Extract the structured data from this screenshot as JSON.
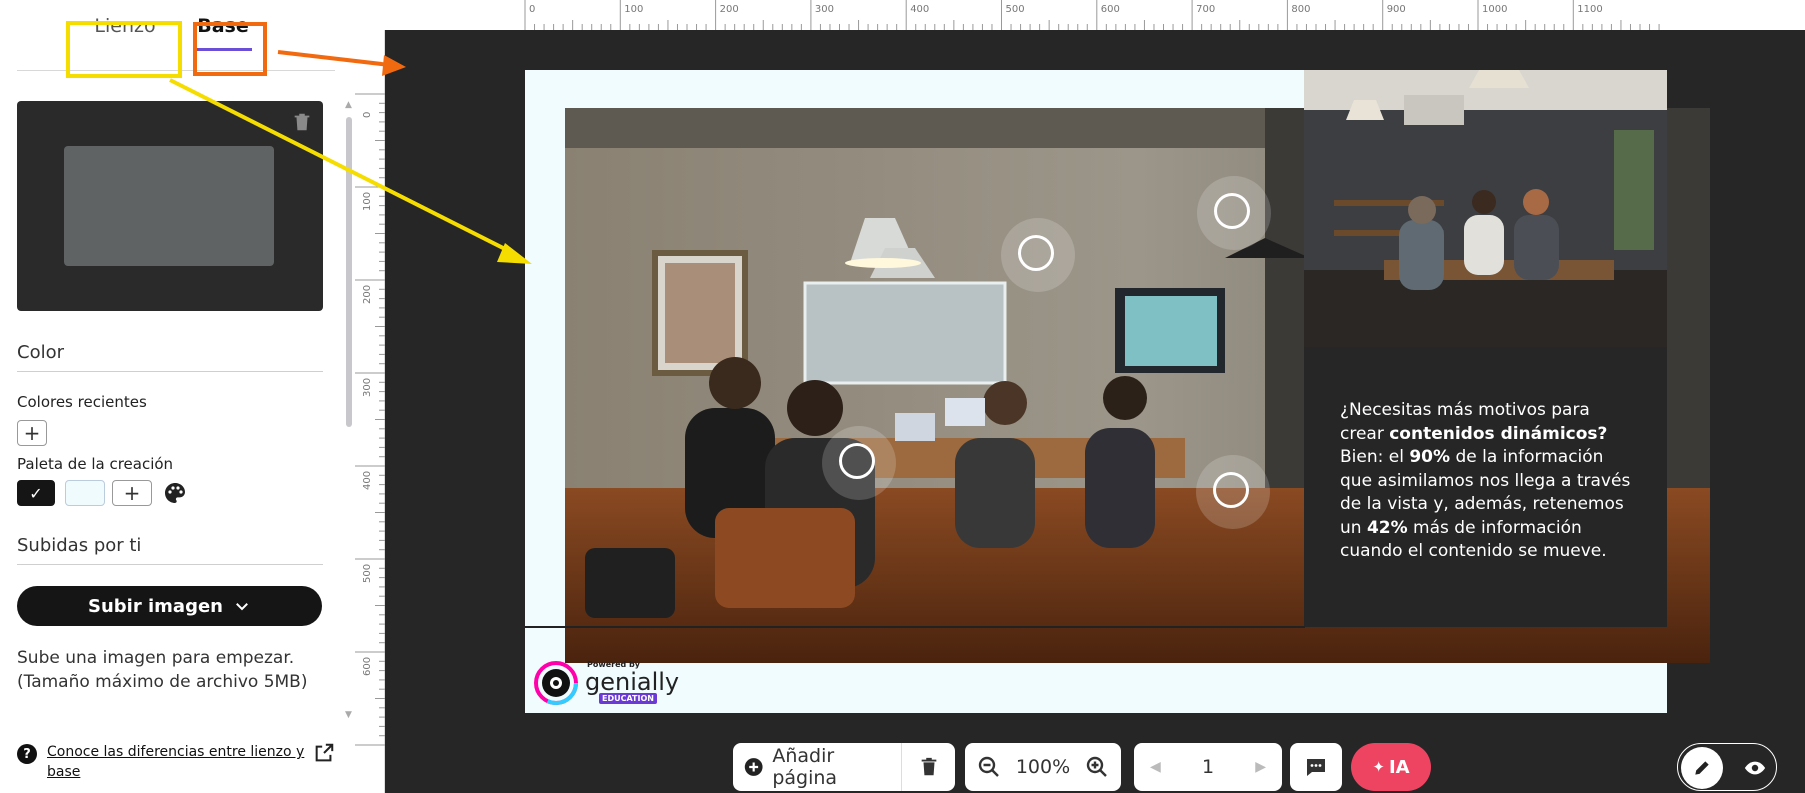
{
  "left_panel": {
    "tabs": [
      {
        "label": "Lienzo"
      },
      {
        "label": "Base"
      }
    ],
    "color": {
      "title": "Color",
      "recent_label": "Colores recientes",
      "palette_label": "Paleta de la creación",
      "palette_swatches": [
        "#151515",
        "#effbfc"
      ]
    },
    "uploads": {
      "title": "Subidas por ti",
      "button_label": "Subir imagen",
      "hint_line1": "Sube una imagen para empezar.",
      "hint_line2": "(Tamaño máximo de archivo 5MB)"
    },
    "help_link": "Conoce las diferencias entre lienzo y base"
  },
  "rulers": {
    "top": [
      "0",
      "100",
      "200",
      "300",
      "400",
      "500",
      "600",
      "700",
      "800",
      "900",
      "1000",
      "1100"
    ],
    "left": [
      "0",
      "100",
      "200",
      "300",
      "400",
      "500",
      "600"
    ]
  },
  "slide": {
    "text_line1": "¿Necesitas más motivos para",
    "text_line2_pre": "crear ",
    "text_line2_bold": "contenidos dinámicos?",
    "text_line3_pre": "Bien: el ",
    "text_line3_bold": "90%",
    "text_line3_post": " de la información",
    "text_line4": "que asimilamos nos llega a través",
    "text_line5": "de la vista y, además, retenemos",
    "text_line6_pre": "un ",
    "text_line6_bold": "42%",
    "text_line6_post": " más de información",
    "text_line7": "cuando el contenido se mueve.",
    "logo_powered": "Powered by",
    "logo_word": "genially",
    "logo_edu": "EDUCATION"
  },
  "toolbar": {
    "add_page_label": "Añadir página",
    "zoom_value": "100%",
    "page_number": "1",
    "ia_label": "IA"
  },
  "colors": {
    "accent_orange": "#f26a10",
    "accent_yellow": "#f5dd00",
    "ia_pink": "#ef4461",
    "tab_underline": "#6b4fd6"
  }
}
